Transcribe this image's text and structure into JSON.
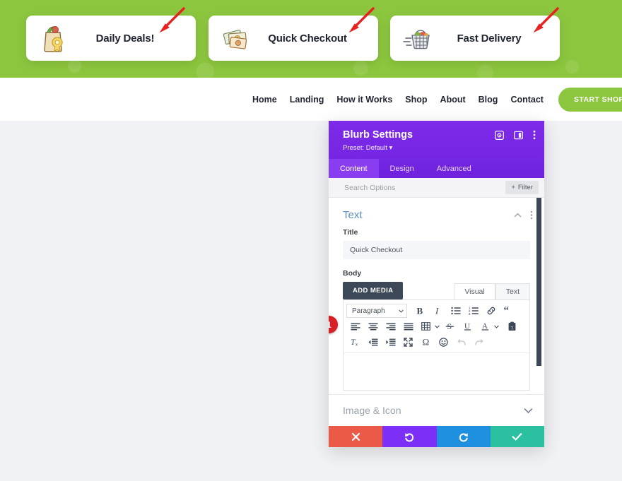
{
  "site": {
    "cards": [
      {
        "title": "Daily Deals!",
        "icon": "grocery-bag-icon"
      },
      {
        "title": "Quick Checkout",
        "icon": "money-bills-icon"
      },
      {
        "title": "Fast Delivery",
        "icon": "shopping-basket-icon"
      }
    ],
    "nav": [
      {
        "label": "Home"
      },
      {
        "label": "Landing"
      },
      {
        "label": "How it Works"
      },
      {
        "label": "Shop"
      },
      {
        "label": "About"
      },
      {
        "label": "Blog"
      },
      {
        "label": "Contact"
      }
    ],
    "cta": {
      "label": "START SHOPPING"
    },
    "colors": {
      "green": "#8cc63e",
      "arrow_red": "#e8201f"
    }
  },
  "modal": {
    "title": "Blurb Settings",
    "preset": "Preset: Default",
    "header_icons": [
      {
        "name": "target-icon"
      },
      {
        "name": "layout-toggle-icon"
      },
      {
        "name": "kebab-menu-icon"
      }
    ],
    "tabs": [
      {
        "label": "Content",
        "active": true
      },
      {
        "label": "Design",
        "active": false
      },
      {
        "label": "Advanced",
        "active": false
      }
    ],
    "search": {
      "placeholder": "Search Options",
      "value": "",
      "filter_label": "Filter"
    },
    "section": {
      "title": "Text",
      "collapse_icon": "chevron-up-icon",
      "menu_icon": "kebab-menu-icon"
    },
    "fields": {
      "title_label": "Title",
      "title_value": "Quick Checkout",
      "body_label": "Body",
      "badge": "1"
    },
    "editor": {
      "add_media_label": "ADD MEDIA",
      "mode_tabs": [
        {
          "label": "Visual",
          "active": true
        },
        {
          "label": "Text",
          "active": false
        }
      ],
      "format_select": "Paragraph",
      "toolbar_row1": [
        {
          "name": "bold-icon",
          "disabled": false
        },
        {
          "name": "italic-icon",
          "disabled": false
        },
        {
          "name": "bullet-list-icon",
          "disabled": false
        },
        {
          "name": "numbered-list-icon",
          "disabled": false
        },
        {
          "name": "link-icon",
          "disabled": false
        },
        {
          "name": "blockquote-icon",
          "disabled": false
        }
      ],
      "toolbar_row2": [
        {
          "name": "align-left-icon",
          "disabled": false
        },
        {
          "name": "align-center-icon",
          "disabled": false
        },
        {
          "name": "align-right-icon",
          "disabled": false
        },
        {
          "name": "align-justify-icon",
          "disabled": false
        },
        {
          "name": "table-icon",
          "disabled": false
        },
        {
          "name": "strikethrough-icon",
          "disabled": false
        },
        {
          "name": "underline-icon",
          "disabled": false
        },
        {
          "name": "text-color-icon",
          "disabled": false
        },
        {
          "name": "paste-as-text-icon",
          "disabled": false
        }
      ],
      "toolbar_row3": [
        {
          "name": "clear-formatting-icon",
          "disabled": false
        },
        {
          "name": "outdent-icon",
          "disabled": false
        },
        {
          "name": "indent-icon",
          "disabled": false
        },
        {
          "name": "fullscreen-icon",
          "disabled": false
        },
        {
          "name": "special-character-icon",
          "disabled": false
        },
        {
          "name": "emoji-icon",
          "disabled": false
        },
        {
          "name": "undo-icon",
          "disabled": true
        },
        {
          "name": "redo-icon",
          "disabled": true
        }
      ],
      "content": ""
    },
    "image_icon_section": {
      "title": "Image & Icon",
      "expand_icon": "chevron-down-icon"
    },
    "footer": [
      {
        "name": "cancel-button",
        "icon": "close-icon",
        "color": "#eb5a47"
      },
      {
        "name": "undo-button",
        "icon": "undo-icon",
        "color": "#7b2ff7"
      },
      {
        "name": "redo-button",
        "icon": "redo-icon",
        "color": "#1f8fe0"
      },
      {
        "name": "save-button",
        "icon": "check-icon",
        "color": "#2ac0a0"
      }
    ]
  }
}
